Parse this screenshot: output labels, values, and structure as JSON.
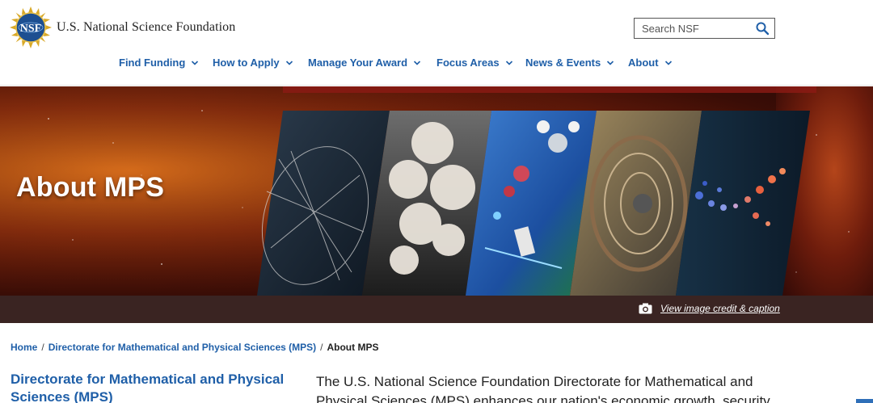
{
  "header": {
    "logo_text": "U.S. National Science Foundation",
    "seal_text": "NSF",
    "search_placeholder": "Search NSF"
  },
  "nav": {
    "items": [
      {
        "label": "Find Funding"
      },
      {
        "label": "How to Apply"
      },
      {
        "label": "Manage Your Award"
      },
      {
        "label": "Focus Areas"
      },
      {
        "label": "News & Events"
      },
      {
        "label": "About"
      }
    ]
  },
  "hero": {
    "title": "About MPS",
    "caption_link": "View image credit & caption"
  },
  "breadcrumb": {
    "home": "Home",
    "parent": "Directorate for Mathematical and Physical Sciences (MPS)",
    "current": "About MPS",
    "separator": "/"
  },
  "content": {
    "side_title": "Directorate for Mathematical and Physical Sciences (MPS)",
    "intro": "The U.S. National Science Foundation Directorate for Mathematical and Physical Sciences (MPS) enhances our nation's economic growth, security"
  },
  "colors": {
    "link_blue": "#1f5fa8",
    "caption_bar": "#3a2422",
    "hero_base": "#8a260c"
  }
}
